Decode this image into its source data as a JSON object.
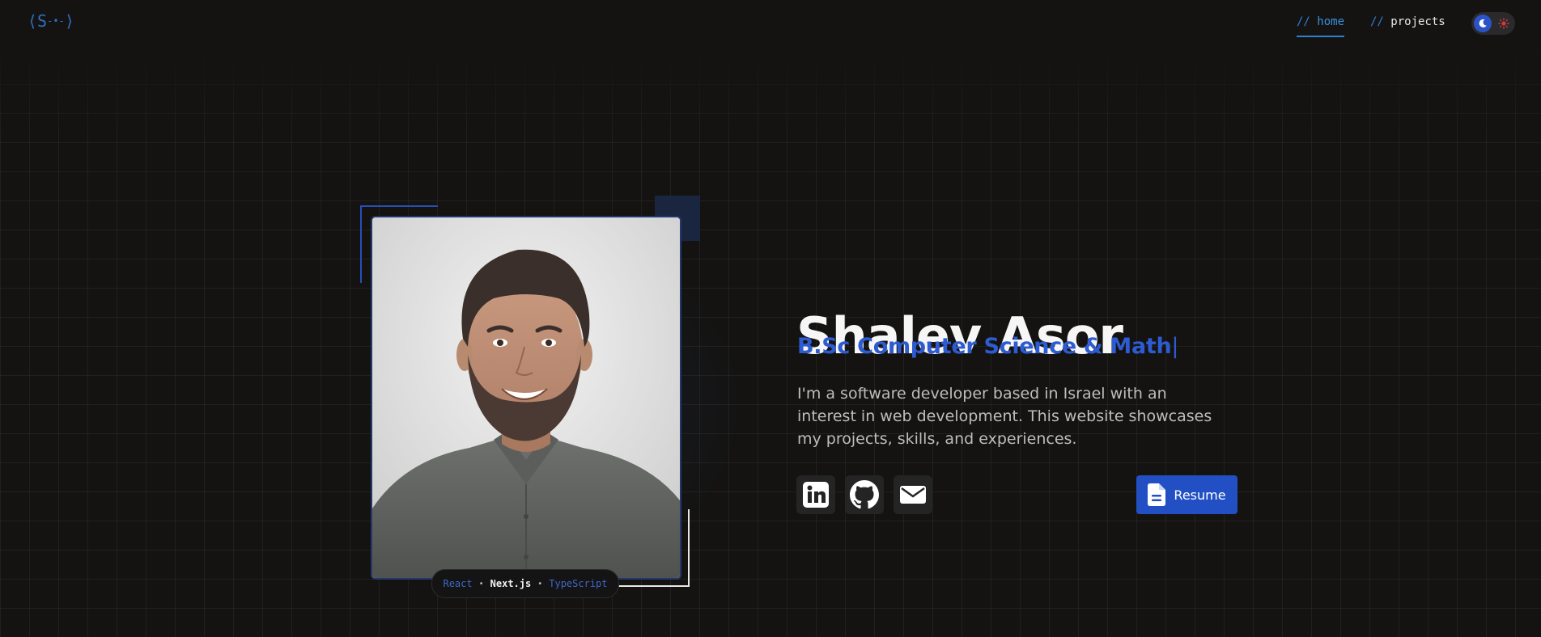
{
  "header": {
    "logo": {
      "left": "⟨S",
      "mid": "-•-",
      "right": "⟩"
    },
    "nav": [
      {
        "prefix": "//",
        "label": "home",
        "active": true
      },
      {
        "prefix": "//",
        "label": "projects",
        "active": false
      }
    ],
    "theme_toggle": {
      "state": "dark",
      "icons": [
        "moon-icon",
        "sun-icon"
      ]
    }
  },
  "hero": {
    "name": "Shalev Asor",
    "subtitle": "B.Sc Computer Science & Math",
    "cursor": "|",
    "bio": "I'm a software developer based in Israel with an interest in web development. This website showcases my projects, skills, and experiences.",
    "social_links": [
      {
        "name": "linkedin",
        "icon": "linkedin-icon"
      },
      {
        "name": "github",
        "icon": "github-icon"
      },
      {
        "name": "email",
        "icon": "mail-icon"
      }
    ],
    "resume_label": "Resume"
  },
  "photo": {
    "alt": "Portrait of Shalev Asor",
    "tech_stack": [
      "React",
      "Next.js",
      "TypeScript"
    ],
    "separator": "•"
  },
  "colors": {
    "background": "#141312",
    "accent_blue": "#2d5bd1",
    "nav_blue": "#2f7fd1",
    "text_primary": "#f6f6f6",
    "text_muted": "#bdbdbd",
    "card": "#252424"
  }
}
